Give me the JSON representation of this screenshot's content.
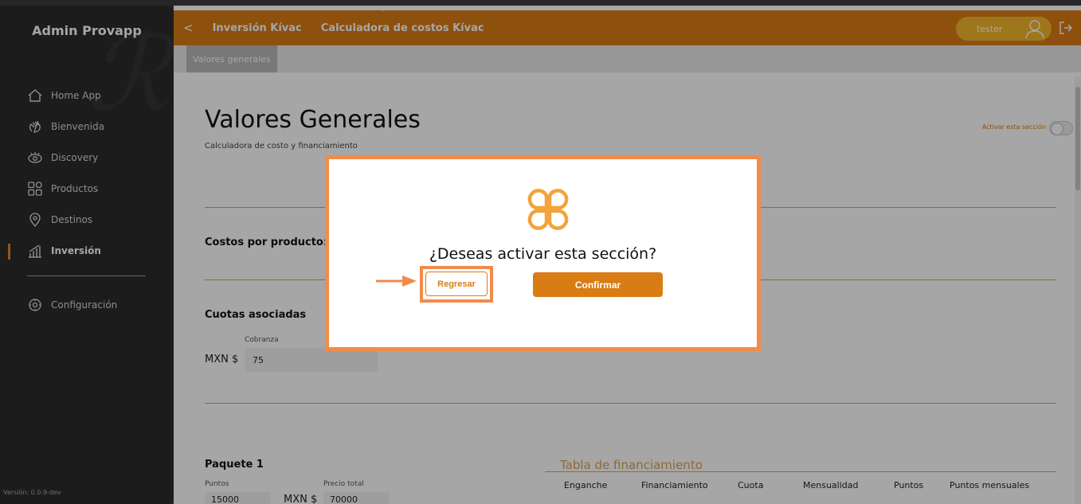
{
  "sidebar": {
    "brand": "Admin Provapp",
    "items": [
      {
        "label": "Home App",
        "icon": "home-icon"
      },
      {
        "label": "Bienvenida",
        "icon": "wave-hand-icon"
      },
      {
        "label": "Discovery",
        "icon": "eye-icon"
      },
      {
        "label": "Productos",
        "icon": "grid-icon"
      },
      {
        "label": "Destinos",
        "icon": "location-pin-icon"
      },
      {
        "label": "Inversión",
        "icon": "chart-icon",
        "active": true
      },
      {
        "label": "Configuración",
        "icon": "gear-icon"
      }
    ],
    "version": "Versión: 0.0.9-dev"
  },
  "header": {
    "back": "<",
    "breadcrumb_1": "Inversión Kívac",
    "breadcrumb_2": "Calculadora de costos Kívac",
    "user": "tester",
    "accent_color": "#d97c14"
  },
  "subnav": {
    "tab": "Valores generales"
  },
  "page": {
    "title": "Valores Generales",
    "subtitle": "Calculadora de costo y financiamiento",
    "toggle_label": "Activar esta sección",
    "section_costos": "Costos por producto: K",
    "section_cuotas": "Cuotas asociadas",
    "cobranza_label": "Cobranza",
    "currency": "MXN $",
    "cobranza_value": "75",
    "paquete": "Paquete 1",
    "puntos_label": "Puntos",
    "precio_label": "Precio total",
    "puntos_value": "15000",
    "precio_currency": "MXN $",
    "precio_value": "70000",
    "fin_title": "Tabla de financiamiento",
    "fin_columns": [
      "Enganche",
      "Financiamiento",
      "Cuota",
      "Mensualidad",
      "Puntos",
      "Puntos mensuales"
    ]
  },
  "modal": {
    "question": "¿Deseas activar esta sección?",
    "back_label": "Regresar",
    "confirm_label": "Confirmar",
    "highlight_color": "#f28b4a"
  }
}
